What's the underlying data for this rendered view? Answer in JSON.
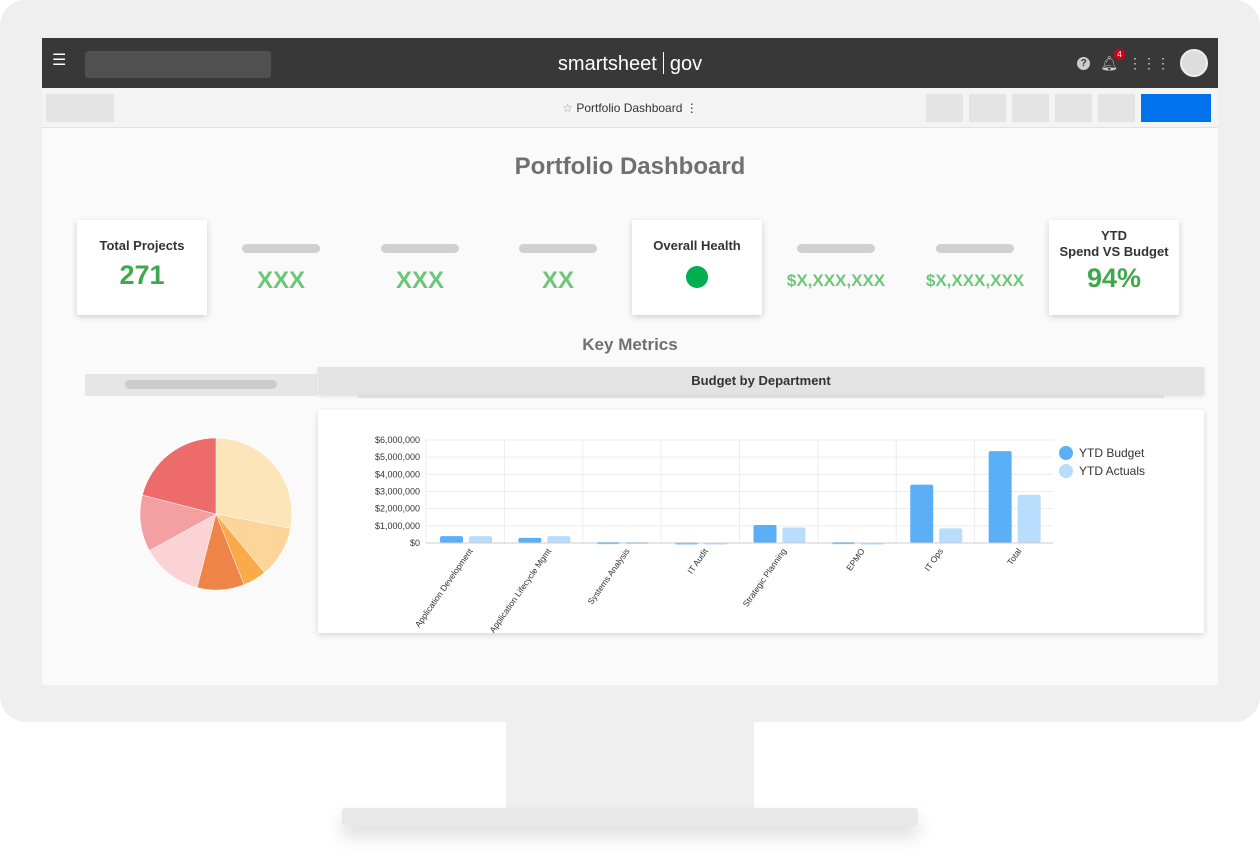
{
  "topbar": {
    "logo_left": "smartsheet",
    "logo_right": "gov",
    "notification_count": "4"
  },
  "toolbar": {
    "title": "Portfolio Dashboard",
    "more": "⋮"
  },
  "page_title": "Portfolio Dashboard",
  "cards": {
    "total_projects": {
      "label": "Total Projects",
      "value": "271"
    },
    "ph1": "XXX",
    "ph2": "XXX",
    "ph3": "XX",
    "overall_health": {
      "label": "Overall Health",
      "status_color": "#00b050"
    },
    "ph4": "$X,XXX,XXX",
    "ph5": "$X,XXX,XXX",
    "ytd": {
      "label1": "YTD",
      "label2": "Spend VS Budget",
      "value": "94%"
    }
  },
  "key_metrics": "Key Metrics",
  "colors": {
    "accent": "#0073ec",
    "green": "#3fa84a",
    "budget": "#5aaff7",
    "actuals": "#b8dcfb"
  },
  "chart_data": [
    {
      "type": "bar",
      "title": "Budget by Department",
      "categories": [
        "Application Development",
        "Application Lifecycle Mgmt",
        "Systems Analysis",
        "IT Audit",
        "Strategic Planning",
        "EPMO",
        "IT Ops",
        "Total"
      ],
      "series": [
        {
          "name": "YTD Budget",
          "values": [
            400000,
            300000,
            50000,
            40000,
            1050000,
            50000,
            3400000,
            5350000
          ]
        },
        {
          "name": "YTD Actuals",
          "values": [
            400000,
            400000,
            60000,
            30000,
            900000,
            30000,
            850000,
            2800000
          ]
        }
      ],
      "yticks": [
        "$0",
        "$1,000,000",
        "$2,000,000",
        "$3,000,000",
        "$4,000,000",
        "$5,000,000",
        "$6,000,000"
      ],
      "ylim": [
        0,
        6000000
      ],
      "grid": true,
      "legend": "top-right"
    },
    {
      "type": "pie",
      "values": [
        28,
        11,
        5,
        10,
        13,
        12,
        21
      ],
      "colors": [
        "#fce5b8",
        "#fdd49a",
        "#fbaa4a",
        "#ef8449",
        "#fbd3d6",
        "#f4a0a2",
        "#ee6b6b"
      ]
    }
  ]
}
